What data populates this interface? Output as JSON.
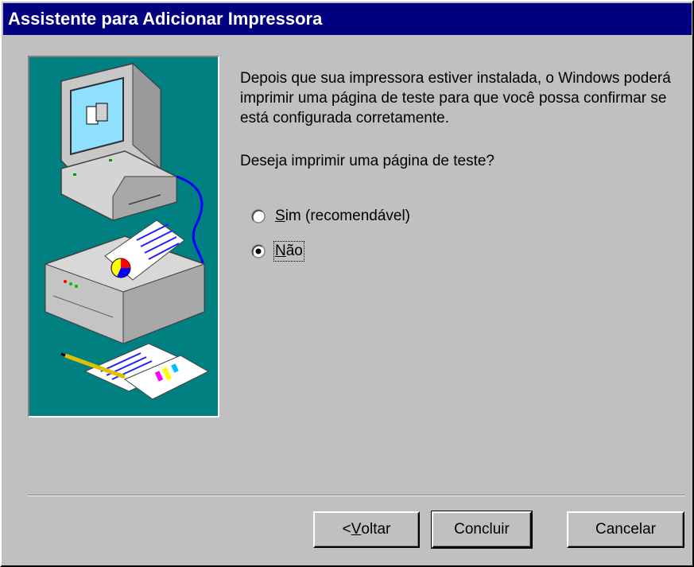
{
  "window": {
    "title": "Assistente para Adicionar Impressora"
  },
  "content": {
    "description": "Depois que sua impressora estiver instalada, o Windows poderá imprimir uma página de teste para que você possa confirmar se está configurada corretamente.",
    "question": "Deseja imprimir uma página de teste?"
  },
  "options": {
    "yes": {
      "accel": "S",
      "rest": "im (recomendável)",
      "selected": false
    },
    "no": {
      "accel": "N",
      "rest": "ão",
      "selected": true
    }
  },
  "buttons": {
    "back": {
      "prefix": "< ",
      "accel": "V",
      "rest": "oltar"
    },
    "finish": "Concluir",
    "cancel": "Cancelar"
  },
  "colors": {
    "title_bar": "#000080",
    "face": "#c0c0c0",
    "illustration_bg": "#008080"
  },
  "illustration": {
    "icons": [
      "computer-icon",
      "printer-icon",
      "documents-icon"
    ]
  }
}
